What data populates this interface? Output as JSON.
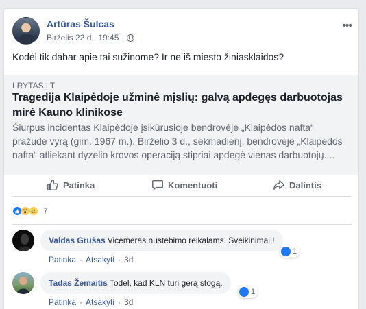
{
  "post": {
    "author": "Artūras Šulcas",
    "date": "Birželis 22 d., 19:45",
    "text": "Kodėl tik dabar apie tai sužinome? Ir ne iš miesto žiniasklaidos?"
  },
  "link": {
    "domain": "LRYTAS.LT",
    "title": "Tragedija Klaipėdoje užminė mįslių: galvą apdegęs darbuotojas mirė Kauno klinikose",
    "description": "Šiurpus incidentas Klaipėdoje įsikūrusioje bendrovėje „Klaipėdos nafta“ pražudė vyrą (gim. 1967 m.). Birželio 3 d., sekmadienį, bendrovėje „Klaipėdos nafta“ atliekant dyzelio krovos operaciją stipriai apdegė vienas darbuotojų...."
  },
  "actions": {
    "like": "Patinka",
    "comment": "Komentuoti",
    "share": "Dalintis"
  },
  "reactions": {
    "count": "7",
    "icons": [
      "like-icon",
      "wow-icon",
      "sad-icon"
    ]
  },
  "comments": [
    {
      "name": "Valdas Grušas",
      "text": "Vicemeras nustebimo reikalams. Sveikinimai !",
      "like_label": "Patinka",
      "reply_label": "Atsakyti",
      "time": "3d",
      "reaction_count": "1"
    },
    {
      "name": "Tadas Žemaitis",
      "text": "Todėl, kad KLN turi gerą stogą.",
      "like_label": "Patinka",
      "reply_label": "Atsakyti",
      "time": "3d",
      "reaction_count": "1"
    }
  ],
  "colors": {
    "link_blue": "#365899",
    "like_blue": "#2078f4",
    "muted": "#606770",
    "bubble": "#f2f3f5"
  }
}
